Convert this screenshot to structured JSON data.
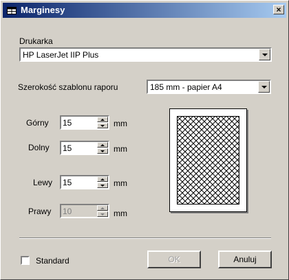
{
  "window": {
    "title": "Marginesy",
    "close_label": "×"
  },
  "printer": {
    "label": "Drukarka",
    "value": "HP LaserJet IIP Plus"
  },
  "template_width": {
    "label": "Szerokość szablonu raporu",
    "value": "185 mm - papier A4"
  },
  "margins": [
    {
      "label": "Górny",
      "value": "15",
      "unit": "mm",
      "enabled": true
    },
    {
      "label": "Dolny",
      "value": "15",
      "unit": "mm",
      "enabled": true
    },
    {
      "label": "Lewy",
      "value": "15",
      "unit": "mm",
      "enabled": true
    },
    {
      "label": "Prawy",
      "value": "10",
      "unit": "mm",
      "enabled": false
    }
  ],
  "standard": {
    "label": "Standard",
    "checked": false
  },
  "buttons": {
    "ok": "OK",
    "cancel": "Anuluj"
  },
  "icons": {
    "title": "table-icon",
    "close": "close-icon",
    "dropdown": "chevron-down-icon"
  }
}
